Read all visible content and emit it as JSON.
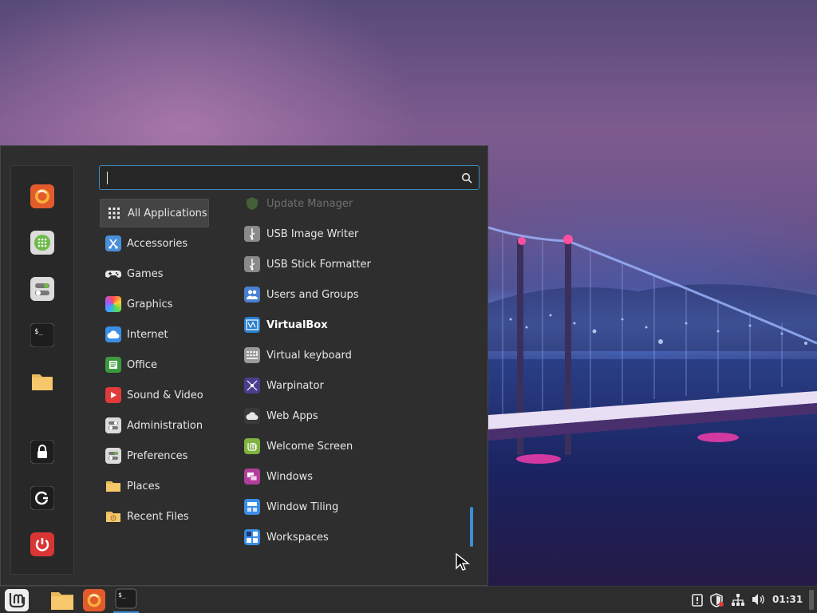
{
  "search": {
    "value": "",
    "placeholder": ""
  },
  "favorites": [
    {
      "name": "firefox-icon"
    },
    {
      "name": "software-manager-icon"
    },
    {
      "name": "system-settings-icon"
    },
    {
      "name": "terminal-icon"
    },
    {
      "name": "files-icon"
    },
    {
      "name": "lock-screen-icon"
    },
    {
      "name": "logout-icon"
    },
    {
      "name": "shutdown-icon"
    }
  ],
  "categories": [
    {
      "label": "All Applications",
      "icon": "grid-icon",
      "selected": true
    },
    {
      "label": "Accessories",
      "icon": "accessories-icon"
    },
    {
      "label": "Games",
      "icon": "games-icon"
    },
    {
      "label": "Graphics",
      "icon": "graphics-icon"
    },
    {
      "label": "Internet",
      "icon": "internet-icon"
    },
    {
      "label": "Office",
      "icon": "office-icon"
    },
    {
      "label": "Sound & Video",
      "icon": "sound-video-icon"
    },
    {
      "label": "Administration",
      "icon": "administration-icon"
    },
    {
      "label": "Preferences",
      "icon": "preferences-icon"
    },
    {
      "label": "Places",
      "icon": "places-icon"
    },
    {
      "label": "Recent Files",
      "icon": "recent-files-icon"
    }
  ],
  "apps": [
    {
      "label": "Update Manager",
      "icon": "shield-icon",
      "faded": true
    },
    {
      "label": "USB Image Writer",
      "icon": "usb-icon"
    },
    {
      "label": "USB Stick Formatter",
      "icon": "usb-icon"
    },
    {
      "label": "Users and Groups",
      "icon": "users-icon"
    },
    {
      "label": "VirtualBox",
      "icon": "virtualbox-icon",
      "bold": true
    },
    {
      "label": "Virtual keyboard",
      "icon": "keyboard-icon"
    },
    {
      "label": "Warpinator",
      "icon": "warpinator-icon"
    },
    {
      "label": "Web Apps",
      "icon": "web-apps-icon"
    },
    {
      "label": "Welcome Screen",
      "icon": "mint-icon"
    },
    {
      "label": "Windows",
      "icon": "windows-icon"
    },
    {
      "label": "Window Tiling",
      "icon": "window-tiling-icon"
    },
    {
      "label": "Workspaces",
      "icon": "workspaces-icon"
    }
  ],
  "panel": {
    "clock": "01:31",
    "launchers": [
      "menu-icon",
      "files-icon",
      "firefox-icon",
      "terminal-icon"
    ],
    "tray": [
      "notifications-icon",
      "update-shield-icon",
      "network-icon",
      "volume-icon"
    ]
  },
  "colors": {
    "accent": "#3b8fd6",
    "menu_bg": "#2e2e2e",
    "panel_bg": "#2d2d2d",
    "mint_green": "#87b158"
  }
}
